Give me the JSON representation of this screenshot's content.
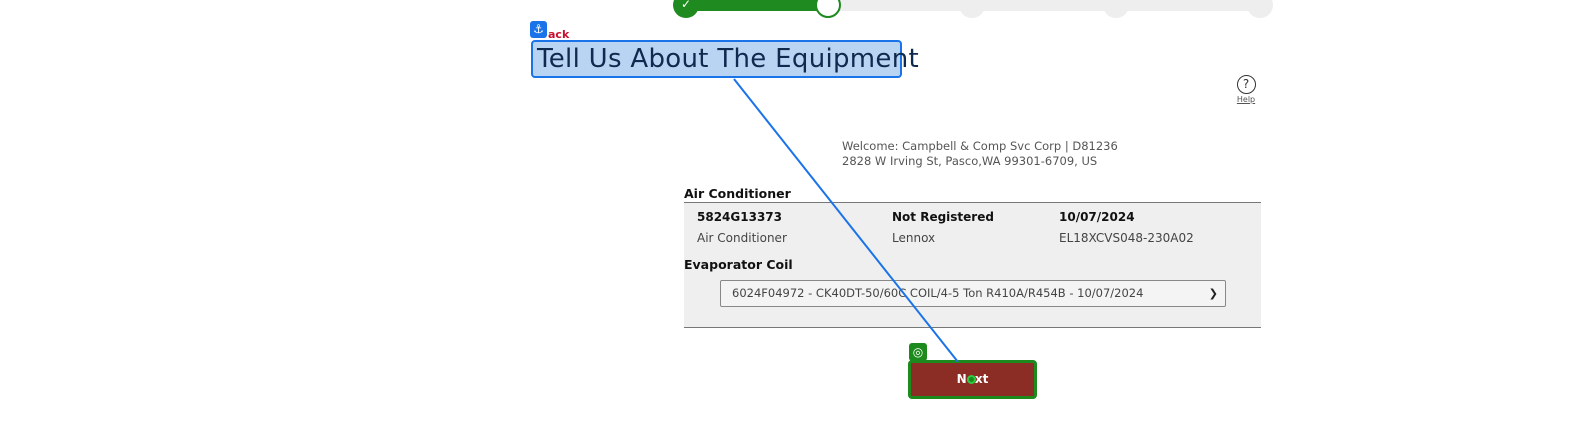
{
  "progress": {
    "done_mark": "✓"
  },
  "back": {
    "label": "ack"
  },
  "page": {
    "title": "Tell Us About The Equipment"
  },
  "help": {
    "icon": "?",
    "label": "Help"
  },
  "welcome": {
    "line1": "Welcome: Campbell & Comp Svc Corp | D81236",
    "line2": "2828 W Irving St, Pasco,WA 99301-6709, US"
  },
  "air_conditioner": {
    "heading": "Air Conditioner",
    "serial": "5824G13373",
    "status": "Not Registered",
    "date": "10/07/2024",
    "type": "Air Conditioner",
    "brand": "Lennox",
    "model": "EL18XCVS048-230A02"
  },
  "evaporator_coil": {
    "heading": "Evaporator Coil",
    "selected": "6024F04972 - CK40DT-50/60C COIL/4-5 Ton R410A/R454B - 10/07/2024"
  },
  "next": {
    "label": "Next"
  },
  "overlay": {
    "anchor_icon": "⚓",
    "target_icon": "◎",
    "accent": "#1a73e8",
    "target_color": "#1c8a1c"
  }
}
